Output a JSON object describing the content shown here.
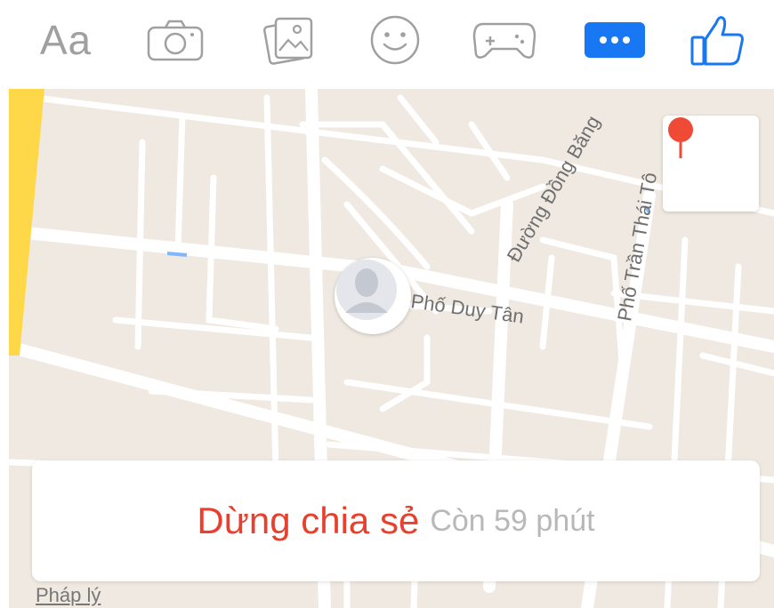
{
  "toolbar": {
    "text_label": "Aa",
    "icons": [
      "camera-icon",
      "gallery-icon",
      "smiley-icon",
      "gamepad-icon",
      "more-icon",
      "thumbs-up-icon"
    ],
    "accent_color": "#1877f2"
  },
  "map": {
    "streets": {
      "duy_tan": "Phố Duy Tân",
      "dong_bang": "Đường Đồng Băng",
      "tran_thai": "Phố Trần Thái Tô"
    }
  },
  "share": {
    "stop_label": "Dừng chia sẻ",
    "remaining": "Còn 59 phút"
  },
  "legal_link": "Pháp lý"
}
